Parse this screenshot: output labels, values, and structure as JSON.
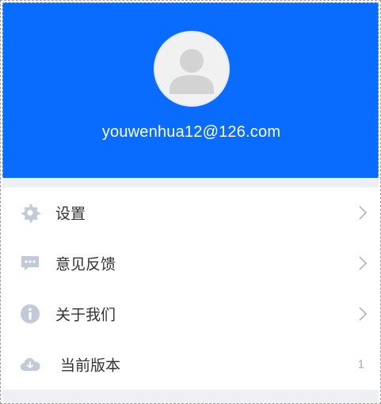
{
  "profile": {
    "email": "youwenhua12@126.com"
  },
  "menu": {
    "items": [
      {
        "label": "设置",
        "icon": "gear-icon"
      },
      {
        "label": "意见反馈",
        "icon": "chat-icon"
      },
      {
        "label": "关于我们",
        "icon": "info-icon"
      },
      {
        "label": "当前版本",
        "icon": "cloud-icon",
        "value": "1"
      }
    ]
  },
  "colors": {
    "header_bg": "#0a6cff",
    "icon": "#c2cad8",
    "text": "#333333",
    "chevron": "#b8b8b8",
    "value": "#aaaaaa"
  }
}
